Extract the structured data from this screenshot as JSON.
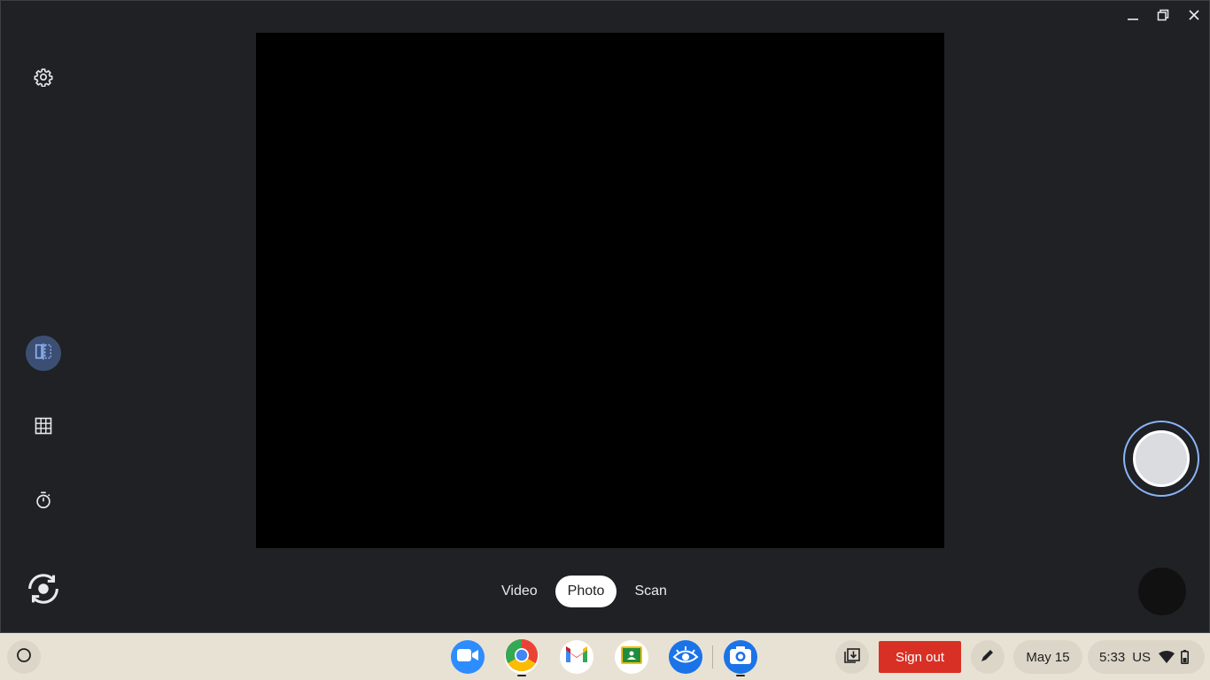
{
  "window": {
    "controls": [
      "minimize-icon",
      "restore-icon",
      "close-icon"
    ]
  },
  "sidebar": {
    "items": [
      {
        "name": "settings",
        "icon": "gear-icon"
      },
      {
        "name": "mirror",
        "icon": "mirror-icon",
        "active": true
      },
      {
        "name": "grid",
        "icon": "grid-icon"
      },
      {
        "name": "timer",
        "icon": "timer-icon"
      },
      {
        "name": "switch-camera",
        "icon": "switch-camera-icon"
      }
    ]
  },
  "modes": {
    "video": "Video",
    "photo": "Photo",
    "scan": "Scan",
    "selected": "Photo"
  },
  "shelf": {
    "apps": [
      {
        "name": "zoom",
        "icon": "zoom-icon",
        "color": "#2d8cff"
      },
      {
        "name": "chrome",
        "icon": "chrome-icon"
      },
      {
        "name": "gmail",
        "icon": "gmail-icon"
      },
      {
        "name": "classroom",
        "icon": "classroom-icon",
        "color": "#1e8e3e"
      },
      {
        "name": "eye-app",
        "icon": "eye-icon",
        "color": "#1a73e8"
      },
      {
        "name": "camera",
        "icon": "camera-icon",
        "color": "#1a73e8"
      }
    ],
    "sign_out": "Sign out",
    "date": "May 15",
    "time": "5:33",
    "locale": "US"
  },
  "colors": {
    "accent": "#8ab4f8",
    "sign_out_bg": "#d93025",
    "shelf_bg": "#e8e2d4"
  }
}
